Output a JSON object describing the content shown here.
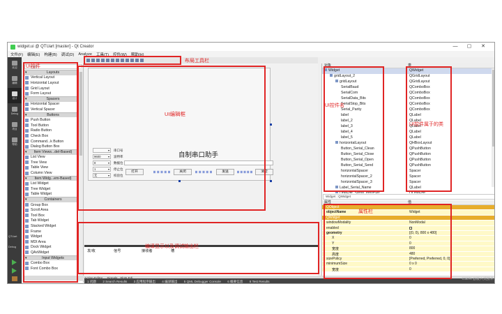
{
  "window": {
    "title": "widget.ui @ QTUart [master] - Qt Creator",
    "controls": [
      "—",
      "▢",
      "✕"
    ]
  },
  "menu": [
    "文件(F)",
    "编辑(E)",
    "构建(B)",
    "调试(D)",
    "Analyze",
    "工具(T)",
    "控件(W)",
    "帮助(H)"
  ],
  "modes": [
    {
      "label": "欢迎",
      "icon": "grid-icon"
    },
    {
      "label": "编辑",
      "icon": "edit-icon"
    },
    {
      "label": "设计",
      "icon": "pen-icon"
    },
    {
      "label": "Debug",
      "icon": "bug-icon"
    },
    {
      "label": "项目",
      "icon": "wrench-icon"
    },
    {
      "label": "帮助",
      "icon": "help-icon"
    }
  ],
  "kit": {
    "project": "QTUart",
    "config": "Debug"
  },
  "widgetbox": {
    "filter_placeholder": "Filter",
    "rows": [
      {
        "type": "cat",
        "text": "Layouts"
      },
      {
        "type": "item",
        "text": "Vertical Layout"
      },
      {
        "type": "item",
        "text": "Horizontal Layout"
      },
      {
        "type": "item",
        "text": "Grid Layout"
      },
      {
        "type": "item",
        "text": "Form Layout"
      },
      {
        "type": "cat",
        "text": "Spacers"
      },
      {
        "type": "item",
        "text": "Horizontal Spacer"
      },
      {
        "type": "item",
        "text": "Vertical Spacer"
      },
      {
        "type": "cat",
        "text": "Buttons"
      },
      {
        "type": "item",
        "text": "Push Button"
      },
      {
        "type": "item",
        "text": "Tool Button"
      },
      {
        "type": "item",
        "text": "Radio Button"
      },
      {
        "type": "item",
        "text": "Check Box"
      },
      {
        "type": "item",
        "text": "Command...k Button"
      },
      {
        "type": "item",
        "text": "Dialog Button Box"
      },
      {
        "type": "cat",
        "text": "Item Views...del-Based)"
      },
      {
        "type": "item",
        "text": "List View"
      },
      {
        "type": "item",
        "text": "Tree View"
      },
      {
        "type": "item",
        "text": "Table View"
      },
      {
        "type": "item",
        "text": "Column View"
      },
      {
        "type": "cat",
        "text": "Item Widg...em-Based)"
      },
      {
        "type": "item",
        "text": "List Widget"
      },
      {
        "type": "item",
        "text": "Tree Widget"
      },
      {
        "type": "item",
        "text": "Table Widget"
      },
      {
        "type": "cat",
        "text": "Containers"
      },
      {
        "type": "item",
        "text": "Group Box"
      },
      {
        "type": "item",
        "text": "Scroll Area"
      },
      {
        "type": "item",
        "text": "Tool Box"
      },
      {
        "type": "item",
        "text": "Tab Widget"
      },
      {
        "type": "item",
        "text": "Stacked Widget"
      },
      {
        "type": "item",
        "text": "Frame"
      },
      {
        "type": "item",
        "text": "Widget"
      },
      {
        "type": "item",
        "text": "MDI Area"
      },
      {
        "type": "item",
        "text": "Dock Widget"
      },
      {
        "type": "item",
        "text": "QAxWidget"
      },
      {
        "type": "cat",
        "text": "Input Widgets"
      },
      {
        "type": "item",
        "text": "Combo Box"
      },
      {
        "type": "item",
        "text": "Font Combo Box"
      }
    ]
  },
  "form": {
    "app_title": "自制串口助手",
    "combo_values": [
      "",
      "9600",
      "8",
      "1",
      "无"
    ],
    "row_labels": [
      "串口号",
      "波特率",
      "数据位",
      "停止位",
      "校验位"
    ],
    "buttons": [
      "打开",
      "关闭",
      "发送",
      "清空"
    ]
  },
  "output": {
    "headers": [
      "发/收",
      "信号",
      "接收者",
      "槽"
    ]
  },
  "bottom_tabs": [
    "Action Editor",
    "Signals _Slots Edi..."
  ],
  "status_items": [
    "1 问题",
    "2 Search Results",
    "3 应用程序输出",
    "4 编译输出",
    "5 QML Debugger Console",
    "6 概要信息",
    "8 Test Results"
  ],
  "objects": {
    "header": [
      "对象",
      "类"
    ],
    "rows": [
      {
        "name": "Widget",
        "cls": "QWidget",
        "indent": 0,
        "selected": true
      },
      {
        "name": "gridLayout_2",
        "cls": "QGridLayout",
        "indent": 1
      },
      {
        "name": "gridLayout",
        "cls": "QGridLayout",
        "indent": 2
      },
      {
        "name": "SerialBaud",
        "cls": "QComboBox",
        "indent": 3
      },
      {
        "name": "SerialCom",
        "cls": "QComboBox",
        "indent": 3
      },
      {
        "name": "SerialData_Bits",
        "cls": "QComboBox",
        "indent": 3
      },
      {
        "name": "SerialStop_Bits",
        "cls": "QComboBox",
        "indent": 3
      },
      {
        "name": "Serial_Parity",
        "cls": "QComboBox",
        "indent": 3
      },
      {
        "name": "label",
        "cls": "QLabel",
        "indent": 3
      },
      {
        "name": "label_2",
        "cls": "QLabel",
        "indent": 3
      },
      {
        "name": "label_3",
        "cls": "QLabel",
        "indent": 3
      },
      {
        "name": "label_4",
        "cls": "QLabel",
        "indent": 3
      },
      {
        "name": "label_5",
        "cls": "QLabel",
        "indent": 3
      },
      {
        "name": "horizontalLayout",
        "cls": "QHBoxLayout",
        "indent": 2
      },
      {
        "name": "Button_Serial_Clean",
        "cls": "QPushButton",
        "indent": 3
      },
      {
        "name": "Button_Serial_Close",
        "cls": "QPushButton",
        "indent": 3
      },
      {
        "name": "Button_Serial_Open",
        "cls": "QPushButton",
        "indent": 3
      },
      {
        "name": "Button_Serial_Send",
        "cls": "QPushButton",
        "indent": 3
      },
      {
        "name": "horizontalSpacer",
        "cls": "Spacer",
        "indent": 3
      },
      {
        "name": "horizontalSpacer_2",
        "cls": "Spacer",
        "indent": 3
      },
      {
        "name": "horizontalSpacer_3",
        "cls": "Spacer",
        "indent": 3
      },
      {
        "name": "Label_Serial_Name",
        "cls": "QLabel",
        "indent": 2
      },
      {
        "name": "LineEdit_Serial_InputSer",
        "cls": "QLineEdit",
        "indent": 2
      }
    ]
  },
  "props": {
    "filter_text": "Widget : QWidget",
    "header": [
      "属性",
      "值"
    ],
    "rows": [
      {
        "k": "QObject",
        "v": "",
        "kind": "group"
      },
      {
        "k": "objectName",
        "v": "Widget",
        "kind": "bold"
      },
      {
        "k": "QWidget",
        "v": "",
        "kind": "group"
      },
      {
        "k": "windowModality",
        "v": "NonModal",
        "kind": "normal"
      },
      {
        "k": "enabled",
        "v": "",
        "kind": "check"
      },
      {
        "k": "geometry",
        "v": "[(0, 0), 800 x 480]",
        "kind": "bold"
      },
      {
        "k": "X",
        "v": "0",
        "kind": "sub"
      },
      {
        "k": "Y",
        "v": "0",
        "kind": "sub"
      },
      {
        "k": "宽度",
        "v": "800",
        "kind": "sub"
      },
      {
        "k": "高度",
        "v": "480",
        "kind": "sub"
      },
      {
        "k": "sizePolicy",
        "v": "[Preferred, Preferred, 0, 0]",
        "kind": "normal"
      },
      {
        "k": "minimumSize",
        "v": "0 x 0",
        "kind": "normal"
      },
      {
        "k": "宽度",
        "v": "0",
        "kind": "sub"
      }
    ]
  },
  "annotations": {
    "widgetbox": "UI控件",
    "toolbar": "布局工具栏",
    "canvas": "UI编辑框",
    "objects": "UI控件名",
    "classes": "UI控件属于的类",
    "props": "属性栏",
    "output": "编译显示以及调试输出栏"
  },
  "watermark": "CSDN @嵌入式技术",
  "colors": {
    "annotation": "#e02424",
    "property_group": "#e7ad2c",
    "property_row": "#fff9c8"
  }
}
